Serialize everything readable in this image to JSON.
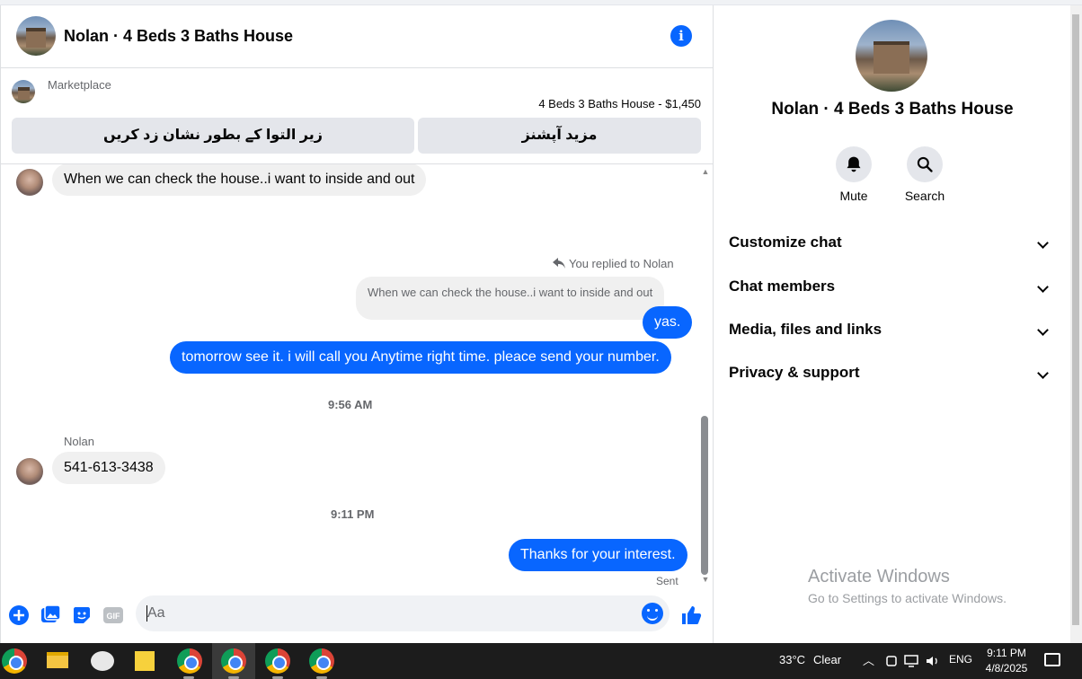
{
  "chat": {
    "title": "Nolan · 4 Beds 3 Baths House",
    "info_icon": "info-icon"
  },
  "marketplace": {
    "label": "Marketplace",
    "listing": "4 Beds 3 Baths House - $1,450",
    "btn_mark_pending": "زیر التوا کے بطور نشان زد کریں",
    "btn_more_options": "مزید آپشنز"
  },
  "messages": {
    "m1": "When we can check the house..i want to inside and out",
    "reply_label": "You replied to Nolan",
    "reply_quote": "When we can check the house..i want to inside and out",
    "m2": "yas.",
    "m3": "tomorrow see it. i will call you Anytime right time. pleace send your number.",
    "time1": "9:56 AM",
    "sender": "Nolan",
    "m4": "541-613-3438",
    "time2": "9:11 PM",
    "m5": "Thanks for your interest.",
    "sent": "Sent"
  },
  "composer": {
    "placeholder": "Aa"
  },
  "info": {
    "title": "Nolan · 4 Beds 3 Baths House",
    "mute": "Mute",
    "search": "Search",
    "sections": [
      "Customize chat",
      "Chat members",
      "Media, files and links",
      "Privacy & support"
    ]
  },
  "watermark": {
    "line1": "Activate Windows",
    "line2": "Go to Settings to activate Windows."
  },
  "taskbar": {
    "weather": "33°C",
    "condition": "Clear",
    "lang": "ENG",
    "time": "9:11 PM",
    "date": "4/8/2025"
  },
  "colors": {
    "accent": "#0866ff",
    "bubble_in": "#f0f0f0"
  }
}
